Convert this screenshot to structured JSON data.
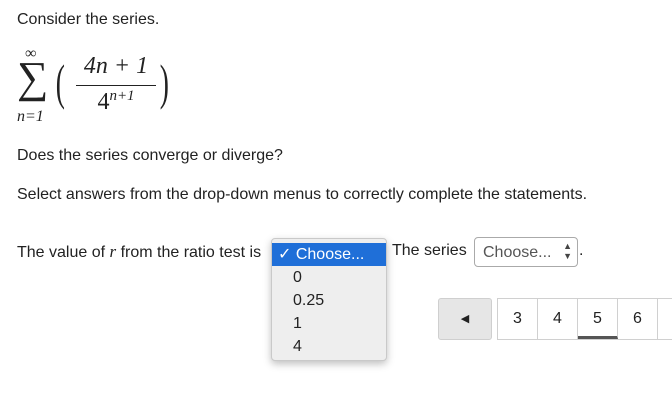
{
  "intro": "Consider the series.",
  "formula": {
    "sum_upper": "∞",
    "sum_symbol": "∑",
    "sum_lower": "n=1",
    "paren_left": "(",
    "paren_right": ")",
    "numerator": "4n + 1",
    "denominator_base": "4",
    "denominator_exp": "n+1"
  },
  "question": "Does the series converge or diverge?",
  "instructions": "Select answers from the drop-down menus to correctly complete the statements.",
  "statement": {
    "part1_prefix": "The value of ",
    "variable": "r",
    "part1_suffix": " from the ratio test is",
    "part2": "The series",
    "period": "."
  },
  "ratio_dropdown": {
    "selected": "✓ Choose...",
    "options": [
      "0",
      "0.25",
      "1",
      "4"
    ]
  },
  "series_select": {
    "value": "Choose...",
    "arrows": "▲▼"
  },
  "pagination": {
    "prev_icon": "◀",
    "pages": [
      "3",
      "4",
      "5",
      "6"
    ],
    "active_page": "5"
  }
}
